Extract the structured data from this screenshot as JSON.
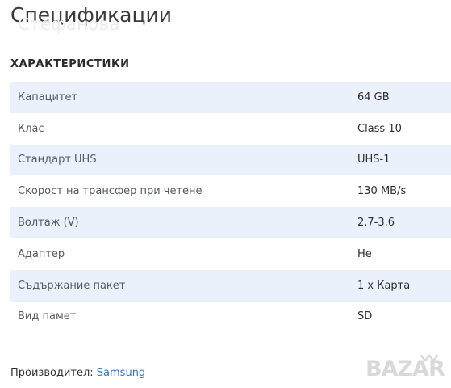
{
  "page": {
    "title": "Спецификации",
    "ghost_text": "Стефанова"
  },
  "specs": {
    "heading": "ХАРАКТЕРИСТИКИ",
    "rows": [
      {
        "label": "Капацитет",
        "value": "64 GB"
      },
      {
        "label": "Клас",
        "value": "Class 10"
      },
      {
        "label": "Стандарт UHS",
        "value": "UHS-1"
      },
      {
        "label": "Скорост на трансфер при четене",
        "value": "130 MB/s"
      },
      {
        "label": "Волтаж (V)",
        "value": "2.7-3.6"
      },
      {
        "label": "Адаптер",
        "value": "Не"
      },
      {
        "label": "Съдържание пакет",
        "value": "1 x Карта"
      },
      {
        "label": "Вид памет",
        "value": "SD"
      }
    ]
  },
  "manufacturer": {
    "label": "Производител:",
    "link_text": "Samsung"
  },
  "watermark": {
    "text": "BAZAR",
    "color": "#d9d9d9"
  },
  "colors": {
    "row_stripe": "#eaf1fb",
    "link": "#2a78c9"
  }
}
